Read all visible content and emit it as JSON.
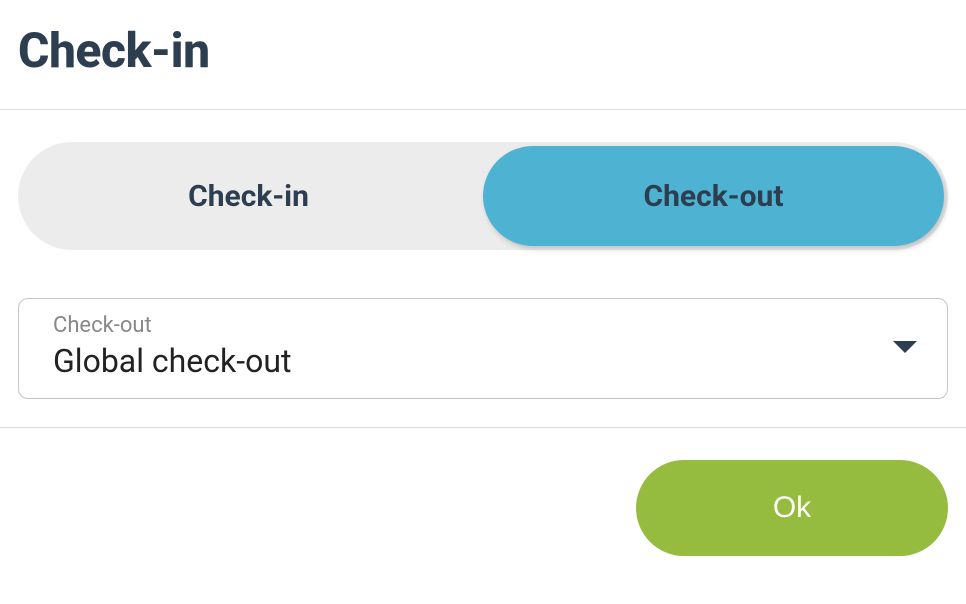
{
  "header": {
    "title": "Check-in"
  },
  "segments": {
    "checkin_label": "Check-in",
    "checkout_label": "Check-out"
  },
  "select": {
    "label": "Check-out",
    "value": "Global check-out"
  },
  "footer": {
    "ok_label": "Ok"
  }
}
